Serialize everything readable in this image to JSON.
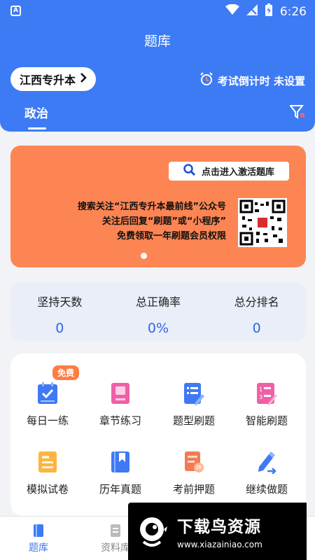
{
  "status_bar": {
    "carrier_icon": "A",
    "time": "6:26"
  },
  "header": {
    "title": "题库",
    "region": "江西专升本",
    "countdown": "考试倒计时 未设置",
    "tab": "政治"
  },
  "banner": {
    "button": "点击进入激活题库",
    "line1": "搜索关注“江西专升本最前线”公众号",
    "line2": "关注后回复“刷题”或“小程序”",
    "line3": "免费领取一年刷题会员权限"
  },
  "stats": [
    {
      "label": "坚持天数",
      "value": "0"
    },
    {
      "label": "总正确率",
      "value": "0%"
    },
    {
      "label": "总分排名",
      "value": "0"
    }
  ],
  "grid": {
    "free_badge": "免费",
    "items": [
      {
        "label": "每日一练",
        "icon": "calendar-check-icon",
        "color": "#3f79f5"
      },
      {
        "label": "章节练习",
        "icon": "book-icon",
        "color": "#f05fa8"
      },
      {
        "label": "题型刷题",
        "icon": "list-edit-icon",
        "color": "#3f79f5"
      },
      {
        "label": "智能刷题",
        "icon": "numbered-list-icon",
        "color": "#f05fa8"
      },
      {
        "label": "模拟试卷",
        "icon": "exam-paper-icon",
        "color": "#ffb340"
      },
      {
        "label": "历年真题",
        "icon": "bookmark-book-icon",
        "color": "#3f79f5"
      },
      {
        "label": "考前押题",
        "icon": "exam-stamp-icon",
        "color": "#f07b55"
      },
      {
        "label": "继续做题",
        "icon": "pencil-icon",
        "color": "#3f79f5"
      }
    ]
  },
  "tabbar": {
    "items": [
      {
        "label": "题库",
        "active": true
      },
      {
        "label": "资料库",
        "active": false
      }
    ]
  },
  "watermark": {
    "main": "下载鸟资源",
    "url": "www.xiazainiao.com"
  }
}
